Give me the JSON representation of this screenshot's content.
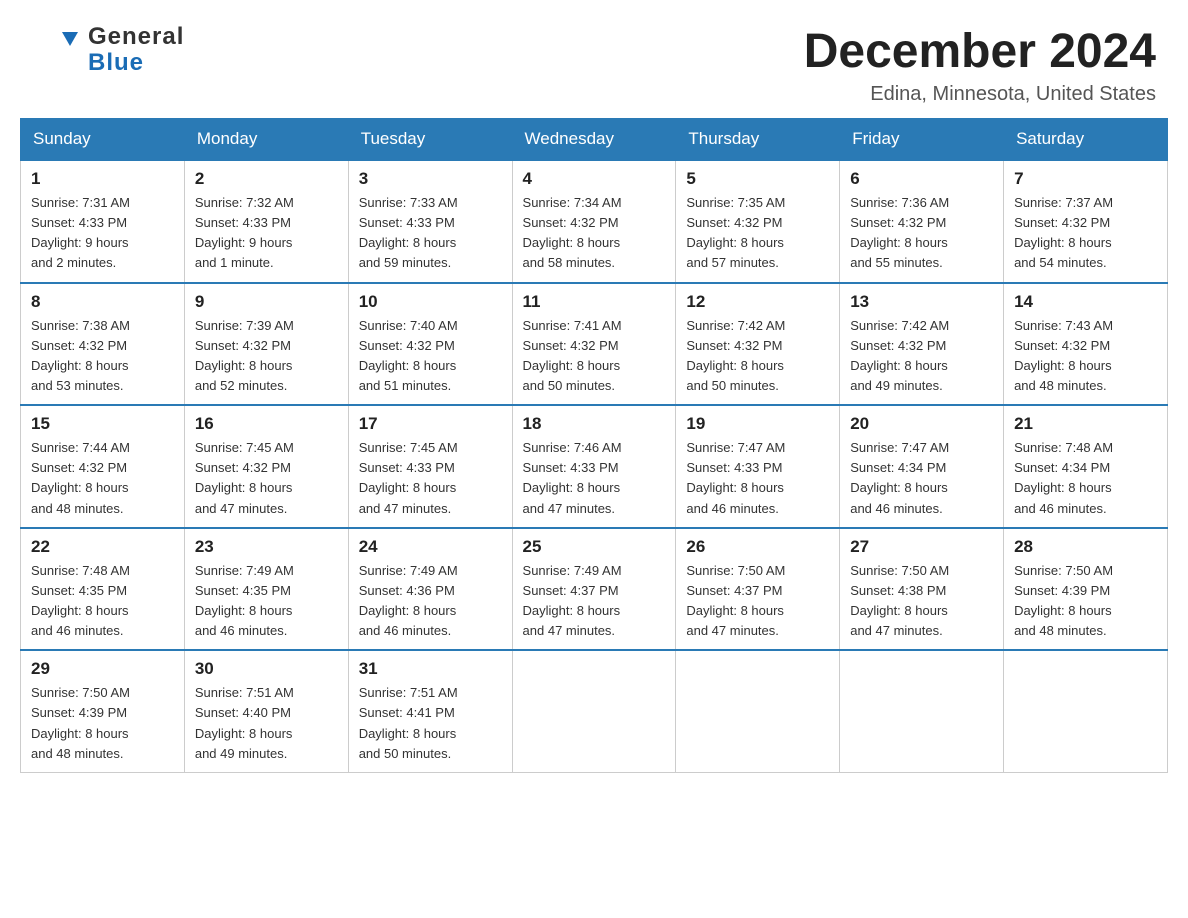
{
  "header": {
    "logo_general": "General",
    "logo_blue": "Blue",
    "month_title": "December 2024",
    "location": "Edina, Minnesota, United States"
  },
  "days_of_week": [
    "Sunday",
    "Monday",
    "Tuesday",
    "Wednesday",
    "Thursday",
    "Friday",
    "Saturday"
  ],
  "weeks": [
    [
      {
        "day": "1",
        "sunrise": "7:31 AM",
        "sunset": "4:33 PM",
        "daylight": "9 hours and 2 minutes."
      },
      {
        "day": "2",
        "sunrise": "7:32 AM",
        "sunset": "4:33 PM",
        "daylight": "9 hours and 1 minute."
      },
      {
        "day": "3",
        "sunrise": "7:33 AM",
        "sunset": "4:33 PM",
        "daylight": "8 hours and 59 minutes."
      },
      {
        "day": "4",
        "sunrise": "7:34 AM",
        "sunset": "4:32 PM",
        "daylight": "8 hours and 58 minutes."
      },
      {
        "day": "5",
        "sunrise": "7:35 AM",
        "sunset": "4:32 PM",
        "daylight": "8 hours and 57 minutes."
      },
      {
        "day": "6",
        "sunrise": "7:36 AM",
        "sunset": "4:32 PM",
        "daylight": "8 hours and 55 minutes."
      },
      {
        "day": "7",
        "sunrise": "7:37 AM",
        "sunset": "4:32 PM",
        "daylight": "8 hours and 54 minutes."
      }
    ],
    [
      {
        "day": "8",
        "sunrise": "7:38 AM",
        "sunset": "4:32 PM",
        "daylight": "8 hours and 53 minutes."
      },
      {
        "day": "9",
        "sunrise": "7:39 AM",
        "sunset": "4:32 PM",
        "daylight": "8 hours and 52 minutes."
      },
      {
        "day": "10",
        "sunrise": "7:40 AM",
        "sunset": "4:32 PM",
        "daylight": "8 hours and 51 minutes."
      },
      {
        "day": "11",
        "sunrise": "7:41 AM",
        "sunset": "4:32 PM",
        "daylight": "8 hours and 50 minutes."
      },
      {
        "day": "12",
        "sunrise": "7:42 AM",
        "sunset": "4:32 PM",
        "daylight": "8 hours and 50 minutes."
      },
      {
        "day": "13",
        "sunrise": "7:42 AM",
        "sunset": "4:32 PM",
        "daylight": "8 hours and 49 minutes."
      },
      {
        "day": "14",
        "sunrise": "7:43 AM",
        "sunset": "4:32 PM",
        "daylight": "8 hours and 48 minutes."
      }
    ],
    [
      {
        "day": "15",
        "sunrise": "7:44 AM",
        "sunset": "4:32 PM",
        "daylight": "8 hours and 48 minutes."
      },
      {
        "day": "16",
        "sunrise": "7:45 AM",
        "sunset": "4:32 PM",
        "daylight": "8 hours and 47 minutes."
      },
      {
        "day": "17",
        "sunrise": "7:45 AM",
        "sunset": "4:33 PM",
        "daylight": "8 hours and 47 minutes."
      },
      {
        "day": "18",
        "sunrise": "7:46 AM",
        "sunset": "4:33 PM",
        "daylight": "8 hours and 47 minutes."
      },
      {
        "day": "19",
        "sunrise": "7:47 AM",
        "sunset": "4:33 PM",
        "daylight": "8 hours and 46 minutes."
      },
      {
        "day": "20",
        "sunrise": "7:47 AM",
        "sunset": "4:34 PM",
        "daylight": "8 hours and 46 minutes."
      },
      {
        "day": "21",
        "sunrise": "7:48 AM",
        "sunset": "4:34 PM",
        "daylight": "8 hours and 46 minutes."
      }
    ],
    [
      {
        "day": "22",
        "sunrise": "7:48 AM",
        "sunset": "4:35 PM",
        "daylight": "8 hours and 46 minutes."
      },
      {
        "day": "23",
        "sunrise": "7:49 AM",
        "sunset": "4:35 PM",
        "daylight": "8 hours and 46 minutes."
      },
      {
        "day": "24",
        "sunrise": "7:49 AM",
        "sunset": "4:36 PM",
        "daylight": "8 hours and 46 minutes."
      },
      {
        "day": "25",
        "sunrise": "7:49 AM",
        "sunset": "4:37 PM",
        "daylight": "8 hours and 47 minutes."
      },
      {
        "day": "26",
        "sunrise": "7:50 AM",
        "sunset": "4:37 PM",
        "daylight": "8 hours and 47 minutes."
      },
      {
        "day": "27",
        "sunrise": "7:50 AM",
        "sunset": "4:38 PM",
        "daylight": "8 hours and 47 minutes."
      },
      {
        "day": "28",
        "sunrise": "7:50 AM",
        "sunset": "4:39 PM",
        "daylight": "8 hours and 48 minutes."
      }
    ],
    [
      {
        "day": "29",
        "sunrise": "7:50 AM",
        "sunset": "4:39 PM",
        "daylight": "8 hours and 48 minutes."
      },
      {
        "day": "30",
        "sunrise": "7:51 AM",
        "sunset": "4:40 PM",
        "daylight": "8 hours and 49 minutes."
      },
      {
        "day": "31",
        "sunrise": "7:51 AM",
        "sunset": "4:41 PM",
        "daylight": "8 hours and 50 minutes."
      },
      null,
      null,
      null,
      null
    ]
  ],
  "labels": {
    "sunrise": "Sunrise:",
    "sunset": "Sunset:",
    "daylight": "Daylight:"
  }
}
